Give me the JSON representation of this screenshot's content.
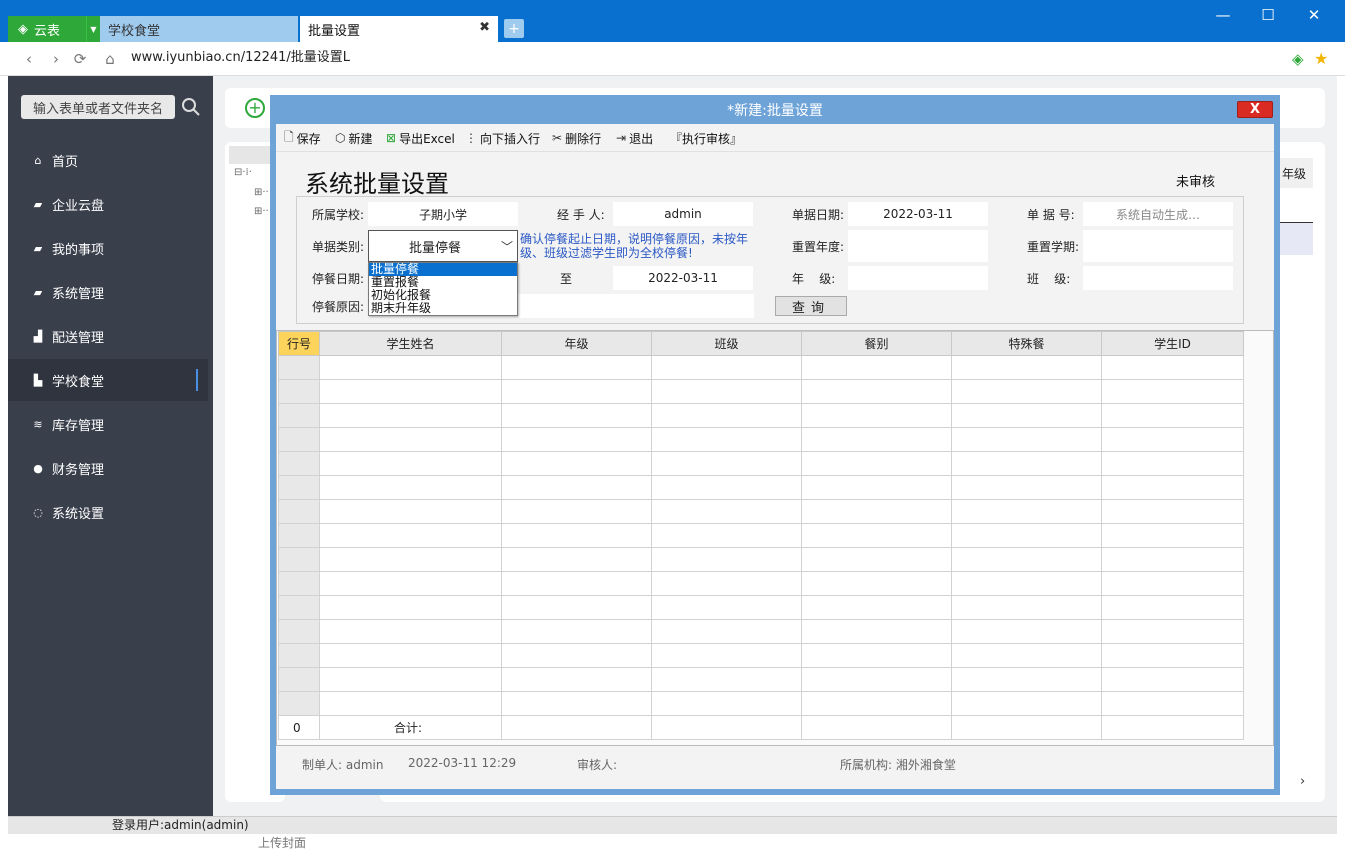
{
  "browser": {
    "logo_label": "云表",
    "tabs": [
      {
        "label": "学校食堂"
      },
      {
        "label": "批量设置"
      }
    ],
    "url": "www.iyunbiao.cn/12241/批量设置L",
    "colors": {
      "chrome": "#0a70d0",
      "brand": "#2fa83a"
    }
  },
  "sidebar": {
    "search_placeholder": "输入表单或者文件夹名",
    "items": [
      {
        "label": "首页",
        "icon": "home-icon"
      },
      {
        "label": "企业云盘",
        "icon": "folder-icon"
      },
      {
        "label": "我的事项",
        "icon": "folder-icon"
      },
      {
        "label": "系统管理",
        "icon": "folder-icon"
      },
      {
        "label": "配送管理",
        "icon": "bar-chart-icon"
      },
      {
        "label": "学校食堂",
        "icon": "bar-chart-icon",
        "active": true
      },
      {
        "label": "库存管理",
        "icon": "database-icon"
      },
      {
        "label": "财务管理",
        "icon": "money-bag-icon"
      },
      {
        "label": "系统设置",
        "icon": "refresh-icon"
      }
    ]
  },
  "status": {
    "user": "登录用户:admin(admin)",
    "below_text": "上传封面"
  },
  "background": {
    "grade_header": "年级"
  },
  "modal": {
    "title": "*新建:批量设置",
    "close_label": "X",
    "toolbar": [
      "保存",
      "新建",
      "导出Excel",
      "向下插入行",
      "删除行",
      "退出",
      "『执行审核』"
    ],
    "form_title": "系统批量设置",
    "audit_status": "未审核",
    "fields": {
      "school_label": "所属学校:",
      "school_value": "子期小学",
      "handler_label": "经 手 人:",
      "handler_value": "admin",
      "date_label": "单据日期:",
      "date_value": "2022-03-11",
      "docno_label": "单 据 号:",
      "docno_placeholder": "系统自动生成…",
      "type_label": "单据类别:",
      "type_value": "批量停餐",
      "reset_year_label": "重置年度:",
      "reset_term_label": "重置学期:",
      "stop_date_label": "停餐日期:",
      "to_label": "至",
      "stop_date_end": "2022-03-11",
      "grade_label": "年    级:",
      "class_label": "班    级:",
      "reason_label": "停餐原因:",
      "query_label": "查询"
    },
    "hint": "确认停餐起止日期，说明停餐原因，未按年级、班级过滤学生即为全校停餐!",
    "type_options": [
      "批量停餐",
      "重置报餐",
      "初始化报餐",
      "期末升年级"
    ],
    "grid": {
      "columns": [
        "行号",
        "学生姓名",
        "年级",
        "班级",
        "餐别",
        "特殊餐",
        "学生ID"
      ],
      "total_row_no": "0",
      "total_label": "合计:"
    },
    "footer": {
      "maker": "制单人: admin",
      "time": "2022-03-11 12:29",
      "auditor": "审核人:",
      "org": "所属机构: 湘外湘食堂"
    }
  }
}
